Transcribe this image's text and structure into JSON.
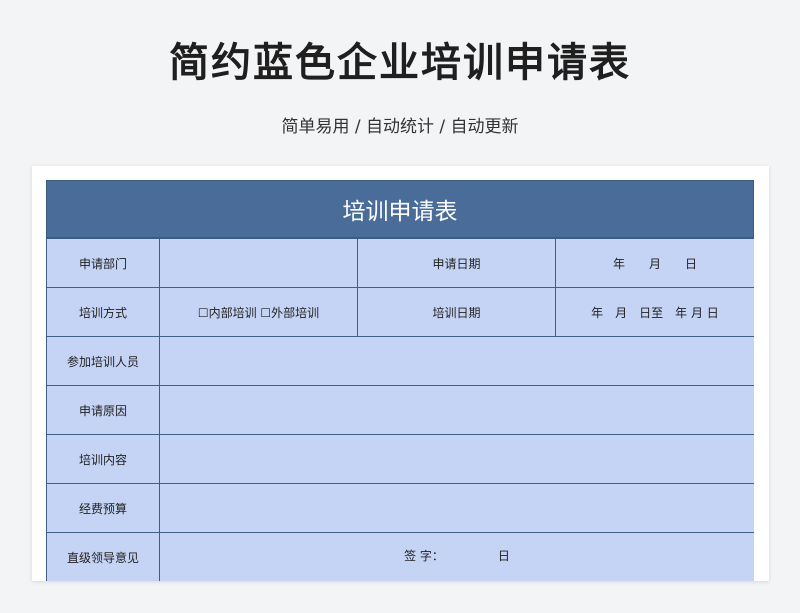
{
  "page": {
    "title": "简约蓝色企业培训申请表",
    "subtitle": "简单易用 / 自动统计 / 自动更新"
  },
  "form": {
    "title": "培训申请表",
    "rows": {
      "dept_label": "申请部门",
      "apply_date_label": "申请日期",
      "apply_date_value": "年　　月　　日",
      "method_label": "培训方式",
      "method_options": "☐内部培训 ☐外部培训",
      "train_date_label": "培训日期",
      "train_date_value": "年　月　日至　年 月 日",
      "participants_label": "参加培训人员",
      "reason_label": "申请原因",
      "content_label": "培训内容",
      "budget_label": "经费预算",
      "supervisor_label": "直级领导意见",
      "signature_value": "签 字：　　　　　日"
    }
  },
  "colors": {
    "header_bg": "#4a6c98",
    "cell_bg": "#c5d3f4",
    "border": "#3f5f87"
  }
}
